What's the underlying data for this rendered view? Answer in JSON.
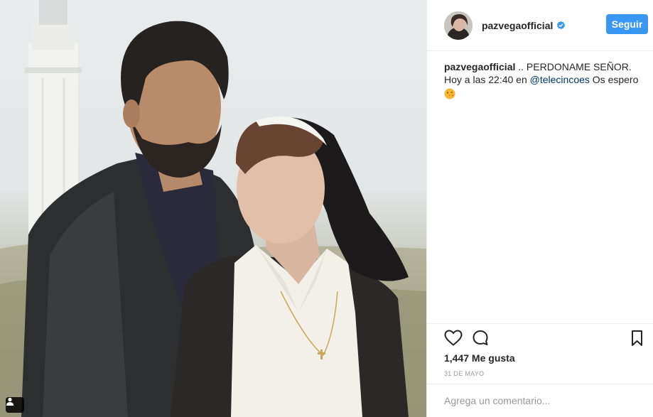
{
  "post": {
    "username": "pazvegaofficial",
    "follow_label": "Seguir",
    "caption": {
      "username": "pazvegaofficial",
      "text_part1": " .. PERDONAME SEÑOR.",
      "text_part2": "Hoy a las 22:40 en ",
      "mention": "@telecincoes",
      "text_part3": " Os espero"
    },
    "likes": "1,447 Me gusta",
    "date": "31 DE MAYO",
    "comment_placeholder": "Agrega un comentario..."
  },
  "colors": {
    "follow_button": "#3897f0",
    "verified_badge": "#3897f0",
    "mention": "#003569"
  },
  "icons": [
    "verified-badge-icon",
    "heart-icon",
    "comment-icon",
    "bookmark-icon",
    "user-tag-icon",
    "kiss-emoji-icon"
  ]
}
